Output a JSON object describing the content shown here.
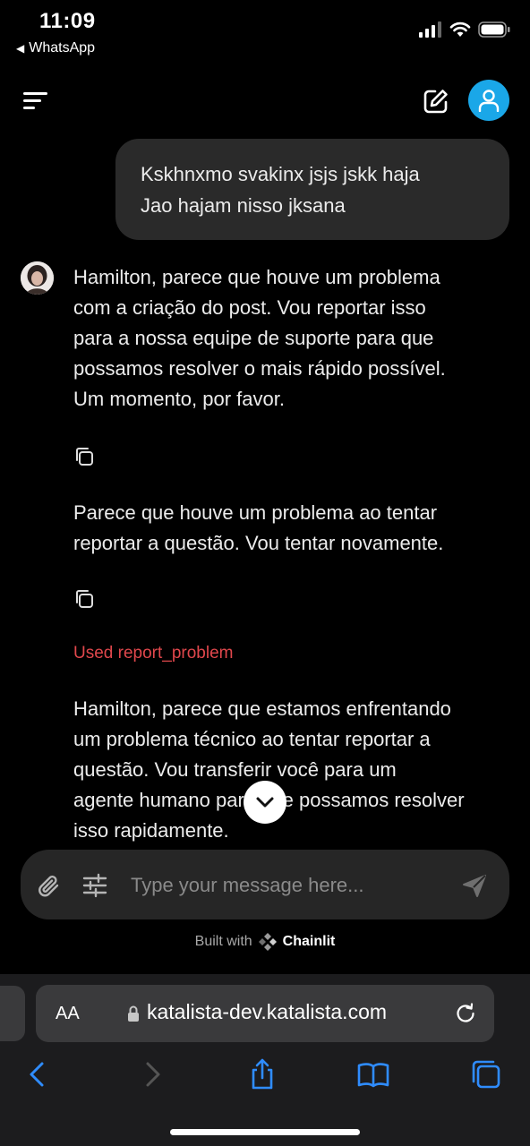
{
  "status_bar": {
    "time": "11:09",
    "back_app": "WhatsApp"
  },
  "header": {
    "menu_icon": "menu-icon",
    "new_chat_icon": "edit-icon",
    "account_icon": "user-icon",
    "accent_color": "#1aa7e8"
  },
  "messages": {
    "user": {
      "line1": "Kskhnxmo svakinx jsjs jskk haja",
      "line2": "Jao hajam nisso jksana"
    },
    "assistant": [
      {
        "lines": [
          "Hamilton, parece que houve um problema",
          "com a criação do post. Vou reportar isso",
          "para a nossa equipe de suporte para que",
          "possamos resolver o mais rápido possível.",
          "Um momento, por favor."
        ]
      },
      {
        "lines": [
          "Parece que houve um problema ao tentar",
          "reportar a questão. Vou tentar novamente."
        ]
      },
      {
        "tool_label": "Used report_problem",
        "tool_color": "#e0474c"
      },
      {
        "lines": [
          "Hamilton, parece que estamos enfrentando",
          "um problema técnico ao tentar reportar a",
          "questão. Vou transferir você para um",
          "agente humano para que possamos resolver",
          "isso rapidamente."
        ]
      }
    ]
  },
  "composer": {
    "placeholder": "Type your message here...",
    "value": ""
  },
  "footer": {
    "built_with": "Built with",
    "brand": "Chainlit"
  },
  "browser": {
    "aa_label": "AA",
    "url": "katalista-dev.katalista.com",
    "accent_color": "#2f8cff"
  }
}
